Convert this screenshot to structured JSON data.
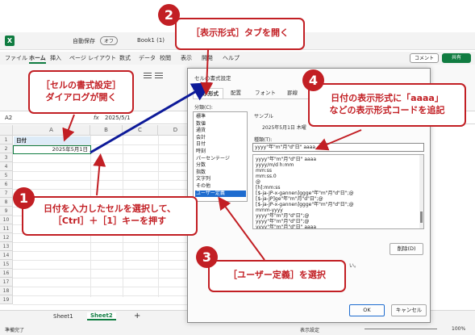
{
  "excel": {
    "title_app": "自動保存",
    "toggle": "オフ",
    "book": "Book1 (1)",
    "menu": [
      "ファイル",
      "ホーム",
      "挿入",
      "ページ レイアウト",
      "数式",
      "データ",
      "校閲",
      "表示",
      "開発",
      "ヘルプ"
    ],
    "comment_button": "コメント",
    "share_button": "共有",
    "name_box": "A2",
    "formula": "2025/5/1",
    "fx": "fx",
    "columns": [
      "A",
      "B",
      "C",
      "D"
    ],
    "rows": [
      "1",
      "2",
      "3",
      "4",
      "5",
      "6",
      "7",
      "8",
      "9",
      "10",
      "11",
      "12",
      "13",
      "14",
      "15",
      "16",
      "17",
      "18",
      "19"
    ],
    "cell_a1": "日付",
    "cell_a2": "2025年5月1日",
    "sheets": [
      "Sheet1",
      "Sheet2"
    ],
    "add_sheet": "+",
    "status_ready": "準備完了",
    "status_display": "表示設定",
    "zoom": "100%"
  },
  "dialog": {
    "title": "セルの書式設定",
    "tabs": [
      "表示形式",
      "配置",
      "フォント",
      "罫線"
    ],
    "category_label": "分類(C):",
    "categories": [
      "標準",
      "数値",
      "通貨",
      "会計",
      "日付",
      "時刻",
      "パーセンテージ",
      "分数",
      "指数",
      "文字列",
      "その他",
      "ユーザー定義"
    ],
    "sample_label": "サンプル",
    "sample_value": "2025年5月1日 木曜",
    "type_label": "種類(T):",
    "type_value": "yyyy\"年\"m\"月\"d\"日\" aaaa",
    "formats": [
      "yyyy\"年\"m\"月\"d\"日\" aaaa",
      "yyyy/m/d h:mm",
      "mm:ss",
      "mm:ss.0",
      "@",
      "[h]:mm:ss",
      "[$-ja-JP-x-gannen]ggge\"年\"m\"月\"d\"日\";@",
      "[$-ja-JP]ge\"年\"m\"月\"d\"日\";@",
      "[$-ja-JP-x-gannen]ggge\"年\"m\"月\"d\"日\";@",
      "mmm-yyyy",
      "yyyy\"年\"m\"月\"d\"日\";@",
      "yyyy\"年\"m\"月\"d\"日\";@",
      "yyyy\"年\"m\"月\"d\"日\" aaaa"
    ],
    "delete_button": "削除(D)",
    "note_tail": "い。",
    "ok": "OK",
    "cancel": "キャンセル"
  },
  "callouts": {
    "c1": {
      "num": "1",
      "line1": "日付を入力したセルを選択して、",
      "line2": "［Ctrl］＋［1］キーを押す"
    },
    "c2": {
      "num": "2",
      "text": "［表示形式］タブを開く"
    },
    "c3": {
      "num": "3",
      "text": "［ユーザー定義］を選択"
    },
    "c4": {
      "num": "4",
      "line1": "日付の表示形式に「aaaa」",
      "line2": "などの表示形式コードを追記"
    },
    "c5": {
      "line1": "［セルの書式設定］",
      "line2": "ダイアログが開く"
    }
  },
  "colors": {
    "accent": "#c21f24",
    "arrow": "#0d1a99",
    "excel_green": "#107c41",
    "select": "#1e6ccf"
  }
}
